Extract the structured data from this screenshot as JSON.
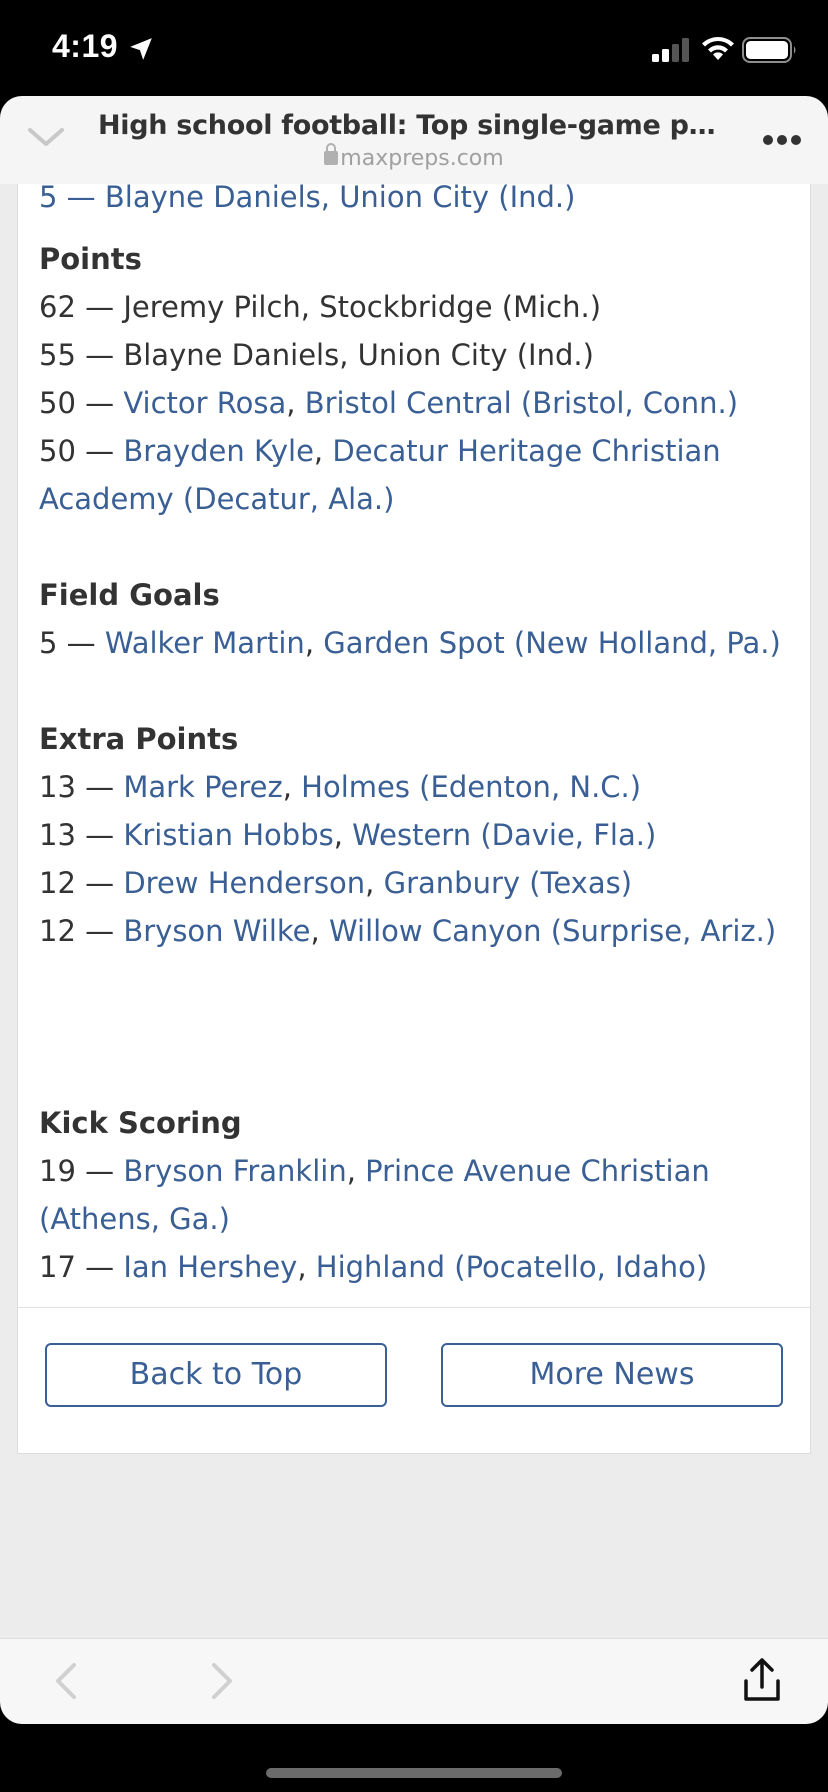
{
  "status_bar": {
    "time": "4:19"
  },
  "browser": {
    "page_title": "High school football: Top single-game perform...",
    "url": "maxpreps.com"
  },
  "article": {
    "cut_line": "5 — Blayne Daniels, Union City (Ind.)",
    "sections": [
      {
        "heading": "Points",
        "entries": [
          {
            "value": "62",
            "player": "Jeremy Pilch",
            "school": "Stockbridge (Mich.)",
            "linked": false
          },
          {
            "value": "55",
            "player": "Blayne Daniels",
            "school": "Union City (Ind.)",
            "linked": false
          },
          {
            "value": "50",
            "player": "Victor Rosa",
            "school": "Bristol Central (Bristol, Conn.)",
            "linked": true
          },
          {
            "value": "50",
            "player": "Brayden Kyle",
            "school_line1": "Decatur Heritage Christian",
            "school_line2": "Academy (Decatur, Ala.)",
            "linked": true
          }
        ]
      },
      {
        "heading": "Field Goals",
        "entries": [
          {
            "value": "5",
            "player": "Walker Martin",
            "school": "Garden Spot (New Holland, Pa.)",
            "linked": true
          }
        ]
      },
      {
        "heading": "Extra Points",
        "entries": [
          {
            "value": "13",
            "player": "Mark Perez",
            "school": "Holmes (Edenton, N.C.)",
            "linked": true
          },
          {
            "value": "13",
            "player": "Kristian Hobbs",
            "school": "Western (Davie, Fla.)",
            "linked": true
          },
          {
            "value": "12",
            "player": "Drew Henderson",
            "school": "Granbury (Texas)",
            "linked": true
          },
          {
            "value": "12",
            "player": "Bryson Wilke",
            "school": "Willow Canyon (Surprise, Ariz.)",
            "linked": true
          }
        ]
      },
      {
        "heading": "Kick Scoring",
        "entries": [
          {
            "value": "19",
            "player": "Bryson Franklin",
            "school_line1": "Prince Avenue Christian",
            "school_line2": "(Athens, Ga.)",
            "linked": true
          },
          {
            "value": "17",
            "player": "Ian Hershey",
            "school": "Highland (Pocatello, Idaho)",
            "linked": true
          }
        ]
      }
    ],
    "dash": "—",
    "comma": ","
  },
  "buttons": {
    "back_to_top": "Back to Top",
    "more_news": "More News"
  },
  "colors": {
    "link": "#3a5f95",
    "text": "#333333",
    "page_bg": "#ececec"
  }
}
